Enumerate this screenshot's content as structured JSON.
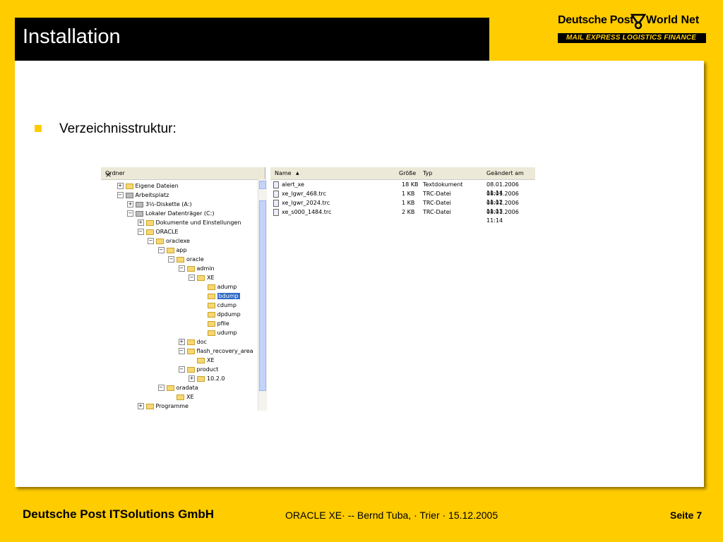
{
  "slide": {
    "title": "Installation",
    "bullet": "Verzeichnisstruktur:"
  },
  "logo": {
    "brand_left": "Deutsche Post",
    "brand_right": "World Net",
    "tagline": "MAIL EXPRESS LOGISTICS FINANCE"
  },
  "explorer": {
    "tree_header": "Ordner",
    "close_label": "×",
    "tree": [
      {
        "label": "Eigene Dateien",
        "pm": "+",
        "icon": "folder"
      },
      {
        "label": "Arbeitsplatz",
        "pm": "−",
        "icon": "computer"
      },
      {
        "label": "3½-Diskette (A:)",
        "pm": "+",
        "icon": "drive"
      },
      {
        "label": "Lokaler Datenträger (C:)",
        "pm": "−",
        "icon": "drive"
      },
      {
        "label": "Dokumente und Einstellungen",
        "pm": "+",
        "icon": "folder"
      },
      {
        "label": "ORACLE",
        "pm": "−",
        "icon": "folder"
      },
      {
        "label": "oraclexe",
        "pm": "−",
        "icon": "folder"
      },
      {
        "label": "app",
        "pm": "−",
        "icon": "folder"
      },
      {
        "label": "oracle",
        "pm": "−",
        "icon": "folder"
      },
      {
        "label": "admin",
        "pm": "−",
        "icon": "folder"
      },
      {
        "label": "XE",
        "pm": "−",
        "icon": "folder"
      },
      {
        "label": "adump",
        "pm": "",
        "icon": "folder"
      },
      {
        "label": "bdump",
        "pm": "",
        "icon": "folder",
        "selected": true
      },
      {
        "label": "cdump",
        "pm": "",
        "icon": "folder"
      },
      {
        "label": "dpdump",
        "pm": "",
        "icon": "folder"
      },
      {
        "label": "pfile",
        "pm": "",
        "icon": "folder"
      },
      {
        "label": "udump",
        "pm": "",
        "icon": "folder"
      },
      {
        "label": "doc",
        "pm": "+",
        "icon": "folder"
      },
      {
        "label": "flash_recovery_area",
        "pm": "−",
        "icon": "folder"
      },
      {
        "label": "XE",
        "pm": "",
        "icon": "folder"
      },
      {
        "label": "product",
        "pm": "−",
        "icon": "folder"
      },
      {
        "label": "10.2.0",
        "pm": "+",
        "icon": "folder"
      },
      {
        "label": "oradata",
        "pm": "−",
        "icon": "folder"
      },
      {
        "label": "XE",
        "pm": "",
        "icon": "folder"
      },
      {
        "label": "Programme",
        "pm": "+",
        "icon": "folder"
      }
    ],
    "columns": {
      "name": "Name",
      "size": "Größe",
      "type": "Typ",
      "modified": "Geändert am"
    },
    "files": [
      {
        "name": "alert_xe",
        "size": "18 KB",
        "type": "Textdokument",
        "modified": "08.01.2006 11:14"
      },
      {
        "name": "xe_lgwr_468.trc",
        "size": "1 KB",
        "type": "TRC-Datei",
        "modified": "08.01.2006 11:12"
      },
      {
        "name": "xe_lgwr_2024.trc",
        "size": "1 KB",
        "type": "TRC-Datei",
        "modified": "08.01.2006 11:13"
      },
      {
        "name": "xe_s000_1484.trc",
        "size": "2 KB",
        "type": "TRC-Datei",
        "modified": "08.01.2006 11:14"
      }
    ]
  },
  "footer": {
    "company": "Deutsche Post ITSolutions GmbH",
    "center": "ORACLE XE· -- Bernd Tuba, · Trier · 15.12.2005",
    "page": "Seite 7"
  }
}
